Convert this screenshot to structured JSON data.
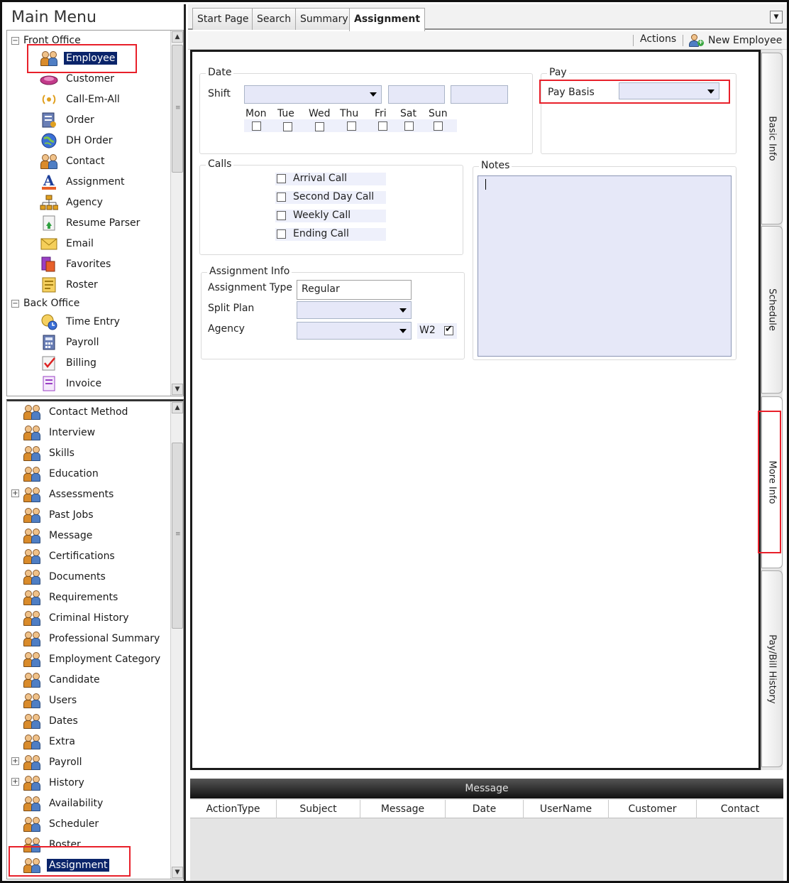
{
  "left_panel": {
    "title": "Main Menu",
    "front_office": {
      "label": "Front Office",
      "items": [
        "Employee",
        "Customer",
        "Call-Em-All",
        "Order",
        "DH Order",
        "Contact",
        "Assignment",
        "Agency",
        "Resume Parser",
        "Email",
        "Favorites",
        "Roster"
      ]
    },
    "back_office": {
      "label": "Back Office",
      "items": [
        "Time Entry",
        "Payroll",
        "Billing",
        "Invoice"
      ]
    },
    "sub_items": [
      "Contact Method",
      "Interview",
      "Skills",
      "Education",
      "Assessments",
      "Past Jobs",
      "Message",
      "Certifications",
      "Documents",
      "Requirements",
      "Criminal History",
      "Professional Summary",
      "Employment Category",
      "Candidate",
      "Users",
      "Dates",
      "Extra",
      "Payroll",
      "History",
      "Availability",
      "Scheduler",
      "Roster",
      "Assignment"
    ],
    "selected_top": "Employee",
    "selected_bottom": "Assignment"
  },
  "tabs": [
    "Start Page",
    "Search",
    "Summary",
    "Assignment"
  ],
  "active_tab": "Assignment",
  "toolbar": {
    "actions": "Actions",
    "new_employee": "New Employee"
  },
  "side_tabs": [
    "Basic Info",
    "Schedule",
    "More Info",
    "Pay/Bill History"
  ],
  "active_side_tab": "More Info",
  "form": {
    "date": {
      "title": "Date",
      "shift_label": "Shift",
      "days": [
        "Mon",
        "Tue",
        "Wed",
        "Thu",
        "Fri",
        "Sat",
        "Sun"
      ]
    },
    "pay": {
      "title": "Pay",
      "pay_basis_label": "Pay Basis"
    },
    "calls": {
      "title": "Calls",
      "items": [
        "Arrival Call",
        "Second Day Call",
        "Weekly Call",
        "Ending Call"
      ]
    },
    "notes": {
      "title": "Notes"
    },
    "assignment_info": {
      "title": "Assignment Info",
      "type_label": "Assignment Type",
      "type_value": "Regular",
      "split_plan_label": "Split Plan",
      "agency_label": "Agency",
      "w2_label": "W2",
      "w2_checked": true
    }
  },
  "messages": {
    "title": "Message",
    "columns": [
      "ActionType",
      "Subject",
      "Message",
      "Date",
      "UserName",
      "Customer",
      "Contact"
    ]
  },
  "colors": {
    "highlight": "#e8202a",
    "selection": "#0a246a",
    "field_fill": "#e6e8f8"
  }
}
